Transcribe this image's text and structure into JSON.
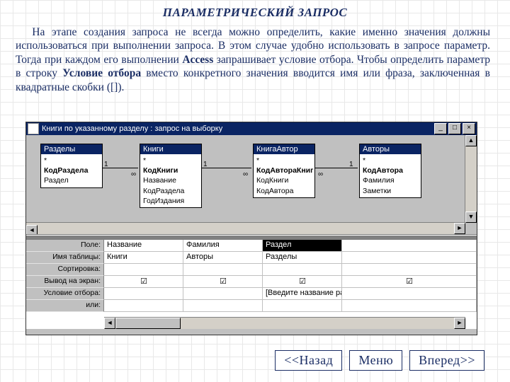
{
  "title": "ПАРАМЕТРИЧЕСКИЙ ЗАПРОС",
  "para_html": "На этапе создания запроса не всегда можно определить, какие именно значения должны использоваться при выполнении запроса. В этом случае удобно использовать в запросе параметр. Тогда при каждом его выполнении <b>Access</b> запрашивает условие отбора. Чтобы определить параметр в строку <b>Условие отбора</b> вместо конкретного значения вводится имя или фраза, заключенная в квадратные скобки ([]).",
  "window": {
    "title": "Книги по указанному разделу : запрос на выборку"
  },
  "tables": [
    {
      "title": "Разделы",
      "fields": [
        "*",
        "<b>КодРаздела</b>",
        "Раздел"
      ]
    },
    {
      "title": "Книги",
      "fields": [
        "*",
        "<b>КодКниги</b>",
        "Название",
        "КодРаздела",
        "ГодИздания"
      ]
    },
    {
      "title": "КнигаАвтор",
      "fields": [
        "*",
        "<b>КодАвтораКниг</b>",
        "КодКниги",
        "КодАвтора"
      ]
    },
    {
      "title": "Авторы",
      "fields": [
        "*",
        "<b>КодАвтора</b>",
        "Фамилия",
        "Заметки"
      ]
    }
  ],
  "gridrows": {
    "labels": [
      "Поле:",
      "Имя таблицы:",
      "Сортировка:",
      "Вывод на экран:",
      "Условие отбора:",
      "или:"
    ],
    "cols": [
      {
        "field": "Название",
        "table": "Книги",
        "sort": "",
        "show": true,
        "crit": ""
      },
      {
        "field": "Фамилия",
        "table": "Авторы",
        "sort": "",
        "show": true,
        "crit": ""
      },
      {
        "field": "Раздел",
        "table": "Разделы",
        "sort": "",
        "show": true,
        "crit": "[Введите название раздела]",
        "selected": true
      }
    ]
  },
  "nav": {
    "back": "<<Назад",
    "menu": "Меню",
    "next": "Вперед>>"
  },
  "joins": {
    "one": "1",
    "many": "∞"
  }
}
